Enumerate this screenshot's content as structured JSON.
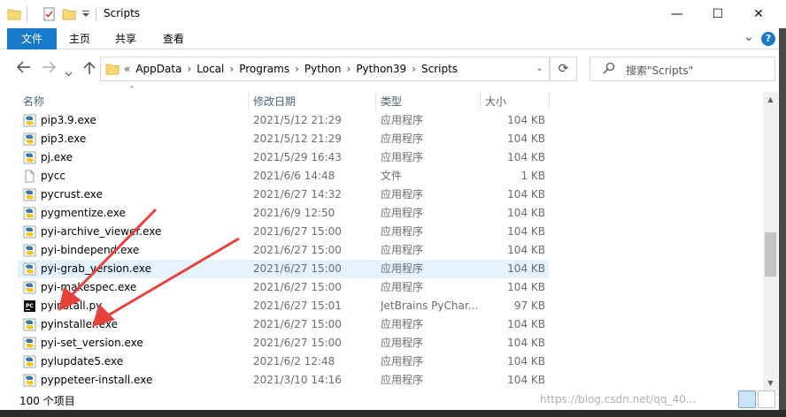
{
  "window": {
    "title": "Scripts",
    "minimize_glyph": "—",
    "maximize_glyph": "☐",
    "close_glyph": "✕"
  },
  "ribbon": {
    "tabs": [
      "文件",
      "主页",
      "共享",
      "查看"
    ],
    "expand_glyph": "⌄",
    "help_glyph": "?"
  },
  "address": {
    "prefix": "«",
    "breadcrumbs": [
      "AppData",
      "Local",
      "Programs",
      "Python",
      "Python39",
      "Scripts"
    ]
  },
  "search": {
    "placeholder": "搜索\"Scripts\""
  },
  "columns": [
    "名称",
    "修改日期",
    "类型",
    "大小"
  ],
  "files": [
    {
      "name": "pip3.9.exe",
      "date": "2021/5/12 21:29",
      "type": "应用程序",
      "size": "104 KB",
      "icon": "python-exe-icon"
    },
    {
      "name": "pip3.exe",
      "date": "2021/5/12 21:29",
      "type": "应用程序",
      "size": "104 KB",
      "icon": "python-exe-icon"
    },
    {
      "name": "pj.exe",
      "date": "2021/5/29 16:43",
      "type": "应用程序",
      "size": "104 KB",
      "icon": "python-exe-icon"
    },
    {
      "name": "pycc",
      "date": "2021/6/6 14:48",
      "type": "文件",
      "size": "1 KB",
      "icon": "blank-file-icon"
    },
    {
      "name": "pycrust.exe",
      "date": "2021/6/27 14:32",
      "type": "应用程序",
      "size": "104 KB",
      "icon": "python-exe-icon"
    },
    {
      "name": "pygmentize.exe",
      "date": "2021/6/9 12:50",
      "type": "应用程序",
      "size": "104 KB",
      "icon": "python-exe-icon"
    },
    {
      "name": "pyi-archive_viewer.exe",
      "date": "2021/6/27 15:00",
      "type": "应用程序",
      "size": "104 KB",
      "icon": "python-exe-icon"
    },
    {
      "name": "pyi-bindepend.exe",
      "date": "2021/6/27 15:00",
      "type": "应用程序",
      "size": "104 KB",
      "icon": "python-exe-icon"
    },
    {
      "name": "pyi-grab_version.exe",
      "date": "2021/6/27 15:00",
      "type": "应用程序",
      "size": "104 KB",
      "icon": "python-exe-icon"
    },
    {
      "name": "pyi-makespec.exe",
      "date": "2021/6/27 15:00",
      "type": "应用程序",
      "size": "104 KB",
      "icon": "python-exe-icon"
    },
    {
      "name": "pyinstall.py",
      "date": "2021/6/27 15:01",
      "type": "JetBrains PyChar...",
      "size": "97 KB",
      "icon": "pycharm-file-icon"
    },
    {
      "name": "pyinstaller.exe",
      "date": "2021/6/27 15:00",
      "type": "应用程序",
      "size": "104 KB",
      "icon": "python-exe-icon"
    },
    {
      "name": "pyi-set_version.exe",
      "date": "2021/6/27 15:00",
      "type": "应用程序",
      "size": "104 KB",
      "icon": "python-exe-icon"
    },
    {
      "name": "pylupdate5.exe",
      "date": "2021/6/2 12:48",
      "type": "应用程序",
      "size": "104 KB",
      "icon": "python-exe-icon"
    },
    {
      "name": "pyppeteer-install.exe",
      "date": "2021/3/10 14:16",
      "type": "应用程序",
      "size": "104 KB",
      "icon": "python-exe-icon"
    }
  ],
  "hover_row_index": 8,
  "status": {
    "item_count": "100 个项目",
    "watermark": "https://blog.csdn.net/qq_40..."
  },
  "colors": {
    "accent": "#1979ca",
    "hover": "#e5f3ff",
    "arrow": "#e8403a"
  }
}
